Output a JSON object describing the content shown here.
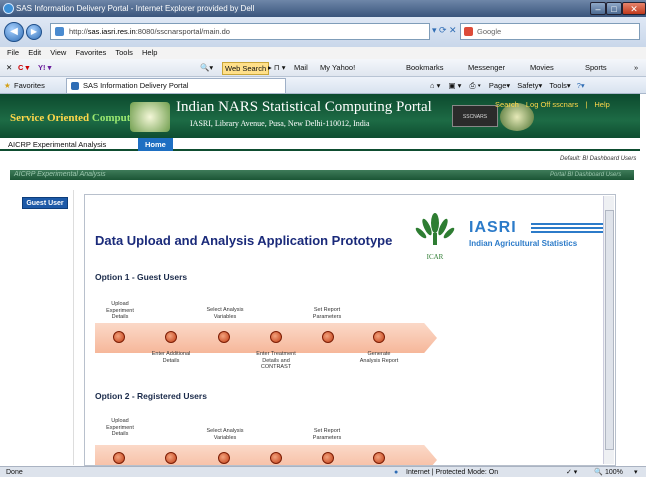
{
  "window": {
    "title": "SAS Information Delivery Portal - Internet Explorer provided by Dell"
  },
  "address_bar": {
    "url_prefix": "http://",
    "url_host": "sas.iasri.res.in",
    "url_rest": ":8080/sscnarsportal/main.do",
    "search_placeholder": "Google"
  },
  "menu": [
    "File",
    "Edit",
    "View",
    "Favorites",
    "Tools",
    "Help"
  ],
  "toolbar": {
    "web_search": "Web Search",
    "mail": "Mail",
    "yahoo": "My Yahoo!",
    "bookmarks": "Bookmarks",
    "messenger": "Messenger",
    "movies": "Movies",
    "sports": "Sports"
  },
  "favorites": {
    "label": "Favorites",
    "tab_title": "SAS Information Delivery Portal",
    "page": "Page",
    "safety": "Safety",
    "tools": "Tools"
  },
  "banner": {
    "left_text_a": "Service Oriented ",
    "left_text_b": "Computing",
    "title": "Indian NARS Statistical Computing Portal",
    "address": "IASRI, Library Avenue, Pusa, New Delhi-110012, India",
    "sscnars": "SSCNARS",
    "links": [
      "Search",
      "Log Off sscnars",
      "Help"
    ]
  },
  "tabs": {
    "aicrp": "AICRP Experimental Analysis",
    "home": "Home"
  },
  "default_label": "Default:  BI Dashboard Users",
  "section": {
    "title": "AICRP Experimental Analysis",
    "right": "Portal BI Dashboard Users"
  },
  "sidebar": {
    "guest_user": "Guest User"
  },
  "content": {
    "title": "Data Upload and Analysis Application Prototype",
    "iasri": "IASRI",
    "iasri_sub": "Indian Agricultural Statistics",
    "icar": "ICAR",
    "option1": "Option 1 - Guest Users",
    "option2": "Option 2 - Registered Users",
    "opt1_top_labels": [
      "Upload Experiment Details",
      "Select Analysis Variables",
      "Set Report Parameters"
    ],
    "opt1_bottom_labels": [
      "Enter Additional Details",
      "Enter Treatment Details and CONTRAST",
      "Generate Analysis Report"
    ],
    "opt2_top_labels": [
      "Upload Experiment Details",
      "Select Analysis Variables",
      "Set Report Parameters"
    ]
  },
  "status": {
    "left": "Done",
    "zone": "Internet | Protected Mode: On",
    "zoom": "100%"
  }
}
